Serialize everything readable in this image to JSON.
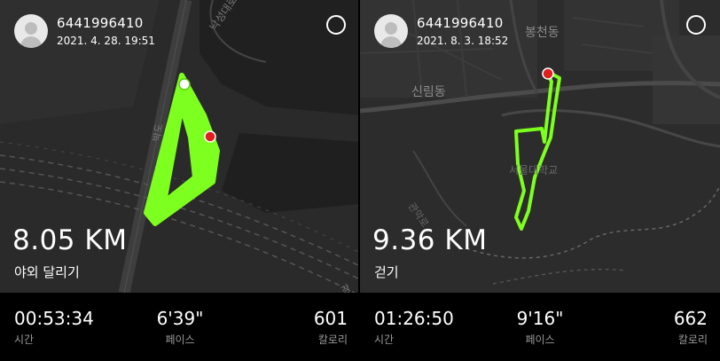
{
  "panels": [
    {
      "user_id": "6441996410",
      "datetime": "2021. 4. 28. 19:51",
      "distance": "8.05 KM",
      "activity": "야외 달리기",
      "stats": {
        "time_value": "00:53:34",
        "time_label": "시간",
        "pace_value": "6'39\"",
        "pace_label": "페이스",
        "calorie_value": "601",
        "calorie_label": "칼로리"
      },
      "map_labels": [
        "낙성대로",
        "박도",
        "강"
      ]
    },
    {
      "user_id": "6441996410",
      "datetime": "2021. 8. 3. 18:52",
      "distance": "9.36 KM",
      "activity": "걷기",
      "stats": {
        "time_value": "01:26:50",
        "time_label": "시간",
        "pace_value": "9'16\"",
        "pace_label": "페이스",
        "calorie_value": "662",
        "calorie_label": "칼로리"
      },
      "map_labels": [
        "봉천동",
        "신림동",
        "서울대학교",
        "관악로"
      ]
    }
  ],
  "colors": {
    "route": "#7dff1f",
    "start_marker": "#ffffff",
    "end_marker": "#e0201f",
    "map_bg": "#2a2a2a",
    "stat_label": "#9a9a9a"
  }
}
